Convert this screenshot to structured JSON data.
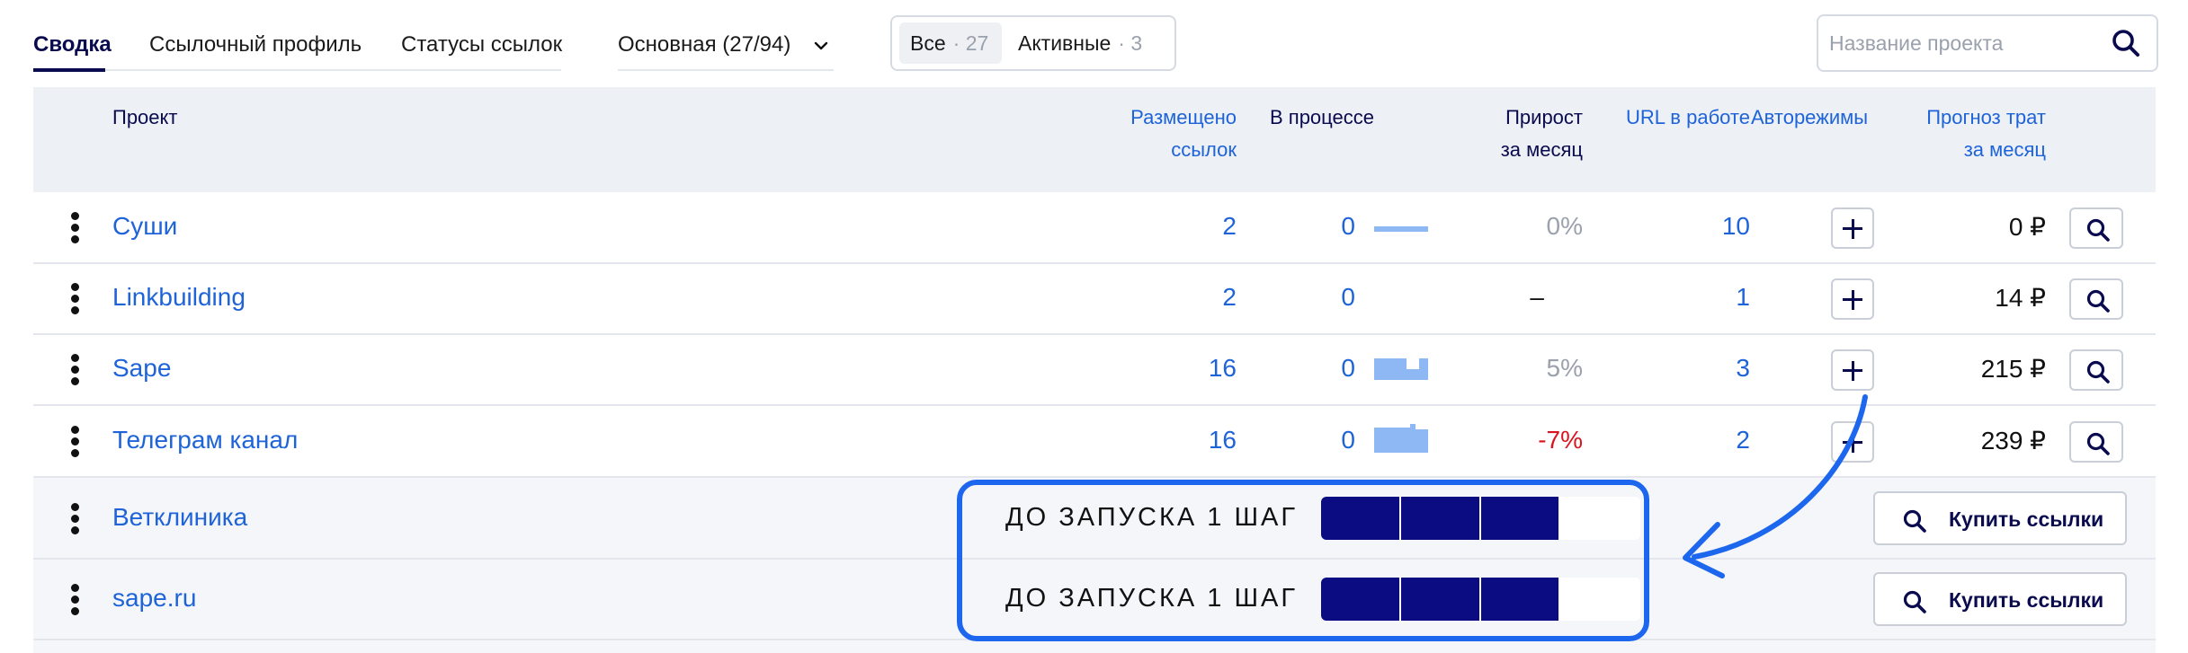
{
  "tabs": [
    {
      "label": "Сводка"
    },
    {
      "label": "Ссылочный профиль"
    },
    {
      "label": "Статусы ссылок"
    }
  ],
  "dropdown": {
    "label": "Основная (27/94)"
  },
  "filter": {
    "all": {
      "label": "Все",
      "count": "· 27"
    },
    "active": {
      "label": "Активные",
      "count": "· 3"
    }
  },
  "search": {
    "placeholder": "Название проекта"
  },
  "columns": {
    "project": "Проект",
    "placed_1": "Размещено",
    "placed_2": "ссылок",
    "in_progress": "В процессе",
    "growth_1": "Прирост",
    "growth_2": "за месяц",
    "url_in_work": "URL в работе",
    "auto_modes": "Авторежимы",
    "forecast_1": "Прогноз трат",
    "forecast_2": "за месяц"
  },
  "rows": [
    {
      "name": "Суши",
      "placed": "2",
      "in_progress": "0",
      "growth": "0%",
      "urls": "10",
      "forecast": "0 ₽"
    },
    {
      "name": "Linkbuilding",
      "placed": "2",
      "in_progress": "0",
      "growth": "–",
      "urls": "1",
      "forecast": "14 ₽"
    },
    {
      "name": "Sape",
      "placed": "16",
      "in_progress": "0",
      "growth": "5%",
      "urls": "3",
      "forecast": "215 ₽"
    },
    {
      "name": "Телеграм канал",
      "placed": "16",
      "in_progress": "0",
      "growth": "-7%",
      "urls": "2",
      "forecast": "239 ₽"
    }
  ],
  "pending_rows": [
    {
      "name": "Ветклиника",
      "step_text": "ДО ЗАПУСКА 1 ШАГ",
      "progress_fraction": 0.75,
      "buy_label": "Купить ссылки"
    },
    {
      "name": "sape.ru",
      "step_text": "ДО ЗАПУСКА 1 ШАГ",
      "progress_fraction": 0.75,
      "buy_label": "Купить ссылки"
    }
  ],
  "colors": {
    "accent_blue": "#1e63d8",
    "navy": "#0a0a4e",
    "progress_fill": "#0b0b82",
    "highlight": "#1d66ee",
    "negative": "#d8141e"
  }
}
